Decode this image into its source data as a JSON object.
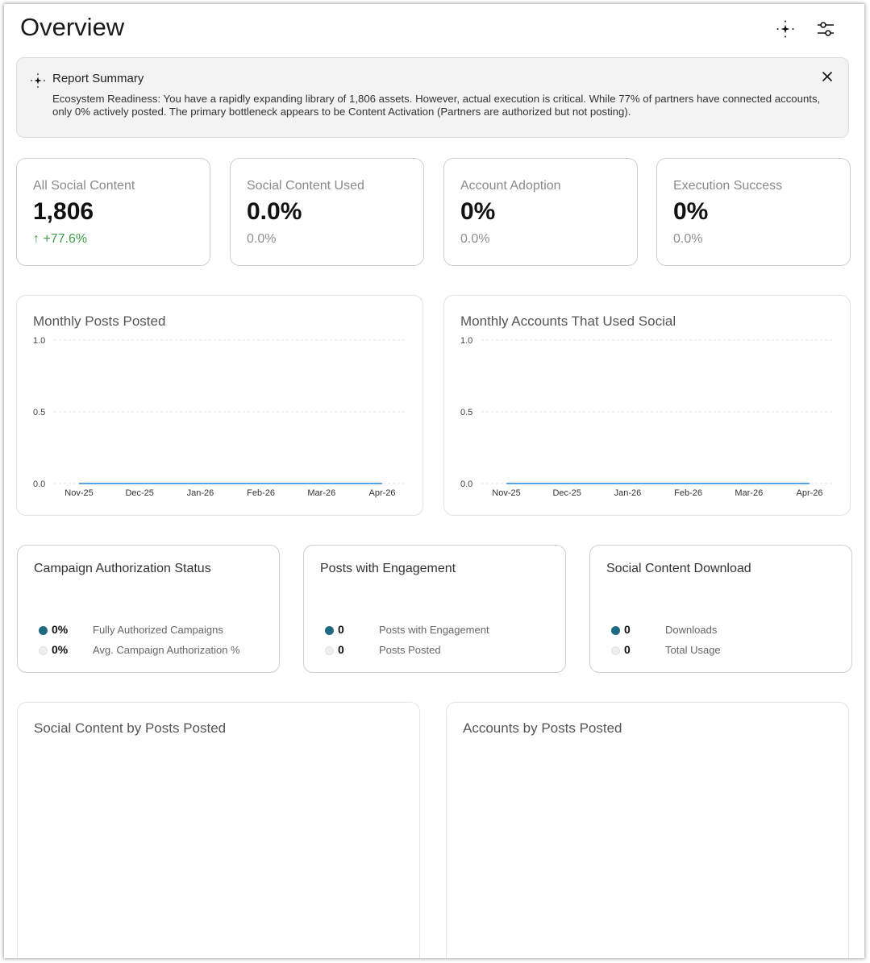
{
  "header": {
    "title": "Overview",
    "icons": {
      "insights": "sparkle-icon",
      "filters": "sliders-icon"
    }
  },
  "summary": {
    "icon": "sparkle-icon",
    "title": "Report Summary",
    "text": "Ecosystem Readiness: You have a rapidly expanding library of 1,806 assets. However, actual execution is critical. While 77% of partners have connected accounts, only 0% actively posted. The primary bottleneck appears to be Content Activation (Partners are authorized but not posting).",
    "close_icon": "close-icon"
  },
  "kpis": [
    {
      "label": "All Social Content",
      "value": "1,806",
      "sub": "↑ +77.6%",
      "trend": "up"
    },
    {
      "label": "Social Content Used",
      "value": "0.0%",
      "sub": "0.0%",
      "trend": "flat"
    },
    {
      "label": "Account Adoption",
      "value": "0%",
      "sub": "0.0%",
      "trend": "flat"
    },
    {
      "label": "Execution Success",
      "value": "0%",
      "sub": "0.0%",
      "trend": "flat"
    }
  ],
  "charts": {
    "posts": {
      "title": "Monthly Posts Posted"
    },
    "accounts": {
      "title": "Monthly Accounts That Used Social"
    }
  },
  "chart_data": [
    {
      "type": "line",
      "title": "Monthly Posts Posted",
      "categories": [
        "Nov-25",
        "Dec-25",
        "Jan-26",
        "Feb-26",
        "Mar-26",
        "Apr-26"
      ],
      "values": [
        0,
        0,
        0,
        0,
        0,
        0
      ],
      "yticks": [
        "1.0",
        "0.5",
        "0.0"
      ],
      "ylim": [
        0,
        1
      ],
      "grid": true,
      "color": "#5aa4e8"
    },
    {
      "type": "line",
      "title": "Monthly Accounts That Used Social",
      "categories": [
        "Nov-25",
        "Dec-25",
        "Jan-26",
        "Feb-26",
        "Mar-26",
        "Apr-26"
      ],
      "values": [
        0,
        0,
        0,
        0,
        0,
        0
      ],
      "yticks": [
        "1.0",
        "0.5",
        "0.0"
      ],
      "ylim": [
        0,
        1
      ],
      "grid": true,
      "color": "#5aa4e8"
    }
  ],
  "minis": [
    {
      "title": "Campaign Authorization Status",
      "rows": [
        {
          "value": "0%",
          "label": "Fully Authorized Campaigns",
          "color": "#1f6a83"
        },
        {
          "value": "0%",
          "label": "Avg. Campaign Authorization %",
          "color": "#eeeeee"
        }
      ]
    },
    {
      "title": "Posts with Engagement",
      "rows": [
        {
          "value": "0",
          "label": "Posts with Engagement",
          "color": "#1f6a83"
        },
        {
          "value": "0",
          "label": "Posts Posted",
          "color": "#eeeeee"
        }
      ]
    },
    {
      "title": "Social Content Download",
      "rows": [
        {
          "value": "0",
          "label": "Downloads",
          "color": "#1f6a83"
        },
        {
          "value": "0",
          "label": "Total Usage",
          "color": "#eeeeee"
        }
      ]
    }
  ],
  "big_cards": [
    {
      "title": "Social Content by Posts Posted"
    },
    {
      "title": "Accounts by Posts Posted"
    }
  ]
}
